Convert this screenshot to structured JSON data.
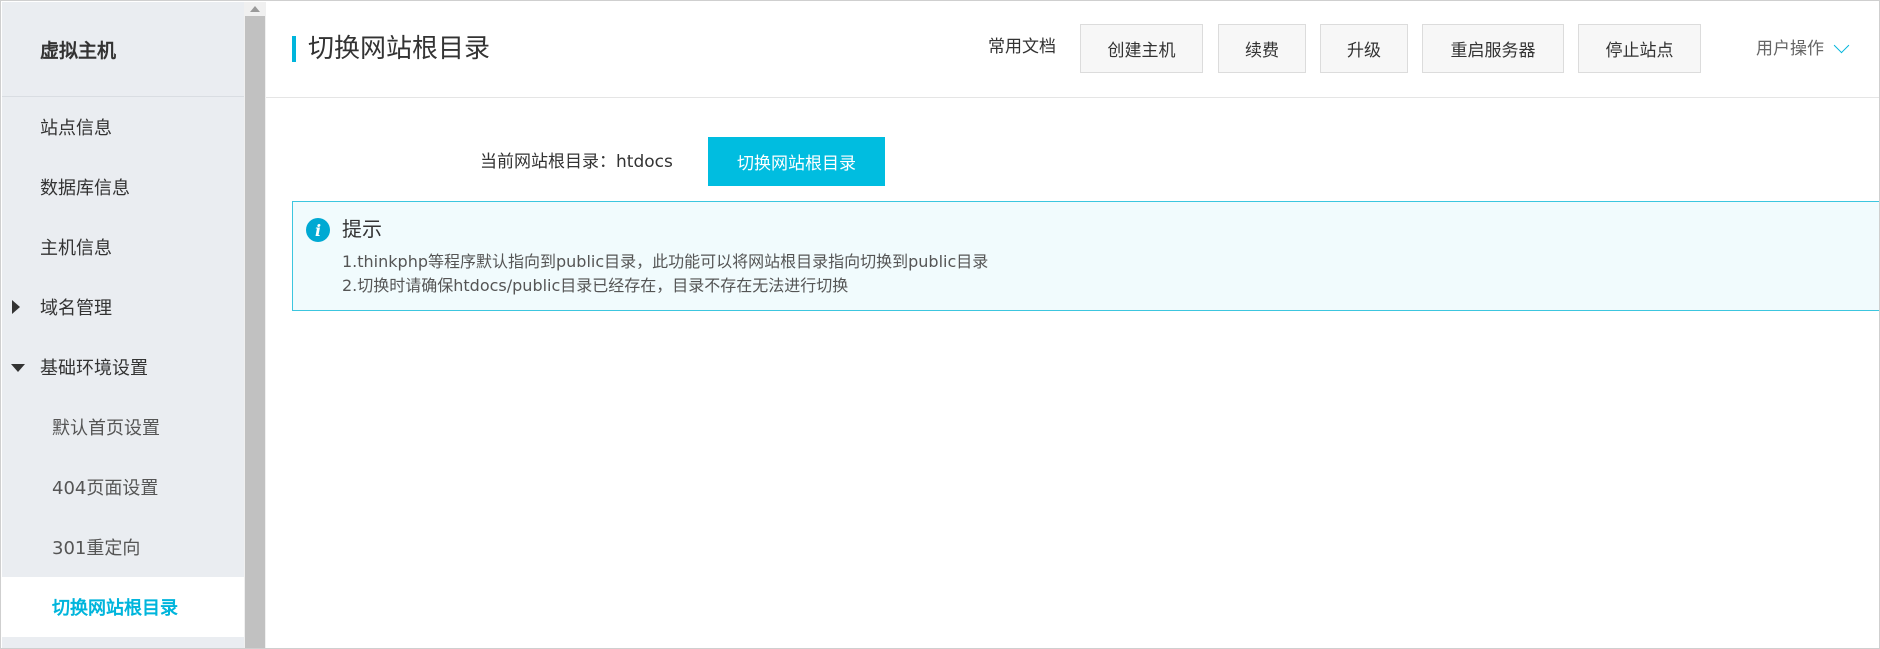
{
  "sidebar": {
    "title": "虚拟主机",
    "items": [
      {
        "label": "站点信息"
      },
      {
        "label": "数据库信息"
      },
      {
        "label": "主机信息"
      },
      {
        "label": "域名管理"
      },
      {
        "label": "基础环境设置"
      },
      {
        "label": "默认首页设置"
      },
      {
        "label": "404页面设置"
      },
      {
        "label": "301重定向"
      },
      {
        "label": "切换网站根目录"
      }
    ]
  },
  "header": {
    "title": "切换网站根目录",
    "docs_label": "常用文档",
    "buttons": {
      "create_host": "创建主机",
      "renew": "续费",
      "upgrade": "升级",
      "restart_server": "重启服务器",
      "stop_site": "停止站点"
    },
    "user_ops": "用户操作"
  },
  "content": {
    "current_root_label": "当前网站根目录：",
    "current_root_value": "htdocs",
    "switch_button": "切换网站根目录",
    "tip": {
      "title": "提示",
      "lines": [
        "1.thinkphp等程序默认指向到public目录，此功能可以将网站根目录指向切换到public目录",
        "2.切换时请确保htdocs/public目录已经存在，目录不存在无法进行切换"
      ]
    }
  },
  "colors": {
    "accent": "#00b5dc",
    "button_primary": "#00bde0",
    "sidebar_bg": "#eaedf1",
    "tip_bg": "#f1fbfd",
    "tip_border": "#3cc6df"
  },
  "icons": {
    "info": "info-icon",
    "expand": "caret-right-icon",
    "collapse": "caret-down-icon",
    "user_menu": "chevron-down-icon"
  }
}
